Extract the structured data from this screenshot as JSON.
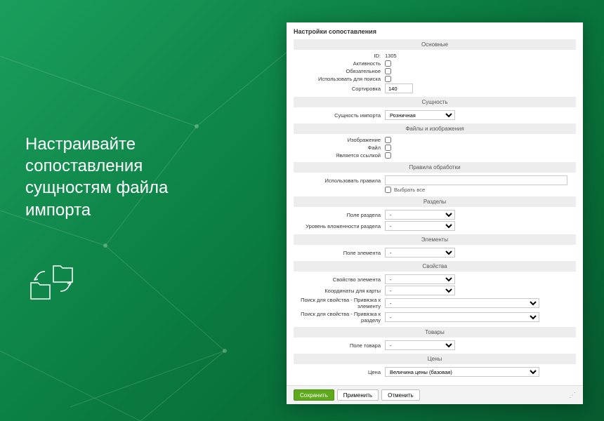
{
  "marketing": {
    "headline": "Настраивайте сопоставления сущностям файла импорта"
  },
  "window": {
    "title": "Настройки сопоставления"
  },
  "sections": {
    "main": {
      "header": "Основные",
      "id_label": "ID:",
      "id_value": "1305",
      "active_label": "Активность",
      "required_label": "Обязательное",
      "search_label": "Использовать для поиска",
      "sort_label": "Сортировка",
      "sort_value": "140"
    },
    "entity": {
      "header": "Сущность",
      "entity_label": "Сущность импорта",
      "entity_value": "Розничная"
    },
    "files": {
      "header": "Файлы и изображения",
      "image_label": "Изображение",
      "file_label": "Файл",
      "link_label": "Является ссылкой"
    },
    "rules": {
      "header": "Правила обработки",
      "use_label": "Использовать правила",
      "select_all_label": "Выбрать все"
    },
    "sections_grp": {
      "header": "Разделы",
      "field_label": "Поле раздела",
      "field_value": "-",
      "depth_label": "Уровень вложенности раздела",
      "depth_value": "-"
    },
    "elements": {
      "header": "Элементы",
      "field_label": "Поле элемента",
      "field_value": "-"
    },
    "props": {
      "header": "Свойства",
      "prop_label": "Свойство элемента",
      "prop_value": "-",
      "coords_label": "Координаты для карты",
      "coords_value": "-",
      "search_el_label": "Поиск для свойства - Привязка к элементу",
      "search_el_value": "-",
      "search_sec_label": "Поиск для свойства - Привязка к разделу",
      "search_sec_value": "-"
    },
    "goods": {
      "header": "Товары",
      "field_label": "Поле товара",
      "field_value": "-"
    },
    "prices": {
      "header": "Цены",
      "price_label": "Цена",
      "price_value": "Величина цены (базовая)"
    }
  },
  "footer": {
    "save": "Сохранить",
    "apply": "Применить",
    "cancel": "Отменить"
  }
}
